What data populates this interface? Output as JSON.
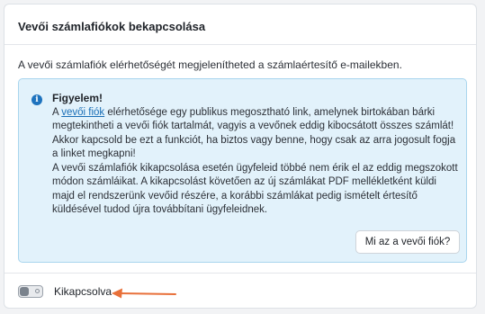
{
  "card": {
    "title": "Vevői számlafiókok bekapcsolása",
    "description": "A vevői számlafiók elérhetőségét megjelenítheted a számlaértesítő e-mailekben."
  },
  "alert": {
    "icon": "info-icon",
    "heading": "Figyelem!",
    "para1_prefix": "A ",
    "para1_link": "vevői fiók",
    "para1_suffix": " elérhetősége egy publikus megosztható link, amelynek birtokában bárki megtekintheti a vevői fiók tartalmát, vagyis a vevőnek eddig kibocsátott összes számlát! Akkor kapcsold be ezt a funkciót, ha biztos vagy benne, hogy csak az arra jogosult fogja a linket megkapni!",
    "para2": "A vevői számlafiók kikapcsolása esetén ügyfeleid többé nem érik el az eddig megszokott módon számláikat. A kikapcsolást követően az új számlákat PDF mellékletként küldi majd el rendszerünk vevőid részére, a korábbi számlákat pedig ismételt értesítő küldésével tudod újra továbbítani ügyfeleidnek.",
    "button_label": "Mi az a vevői fiók?",
    "background_color": "#e2f2fb",
    "border_color": "#a9d5ee",
    "link_color": "#1a6fb7"
  },
  "toggle": {
    "state": "off",
    "label": "Kikapcsolva"
  },
  "annotation": {
    "arrow_icon": "arrow-left-icon",
    "arrow_color": "#e8703a"
  }
}
